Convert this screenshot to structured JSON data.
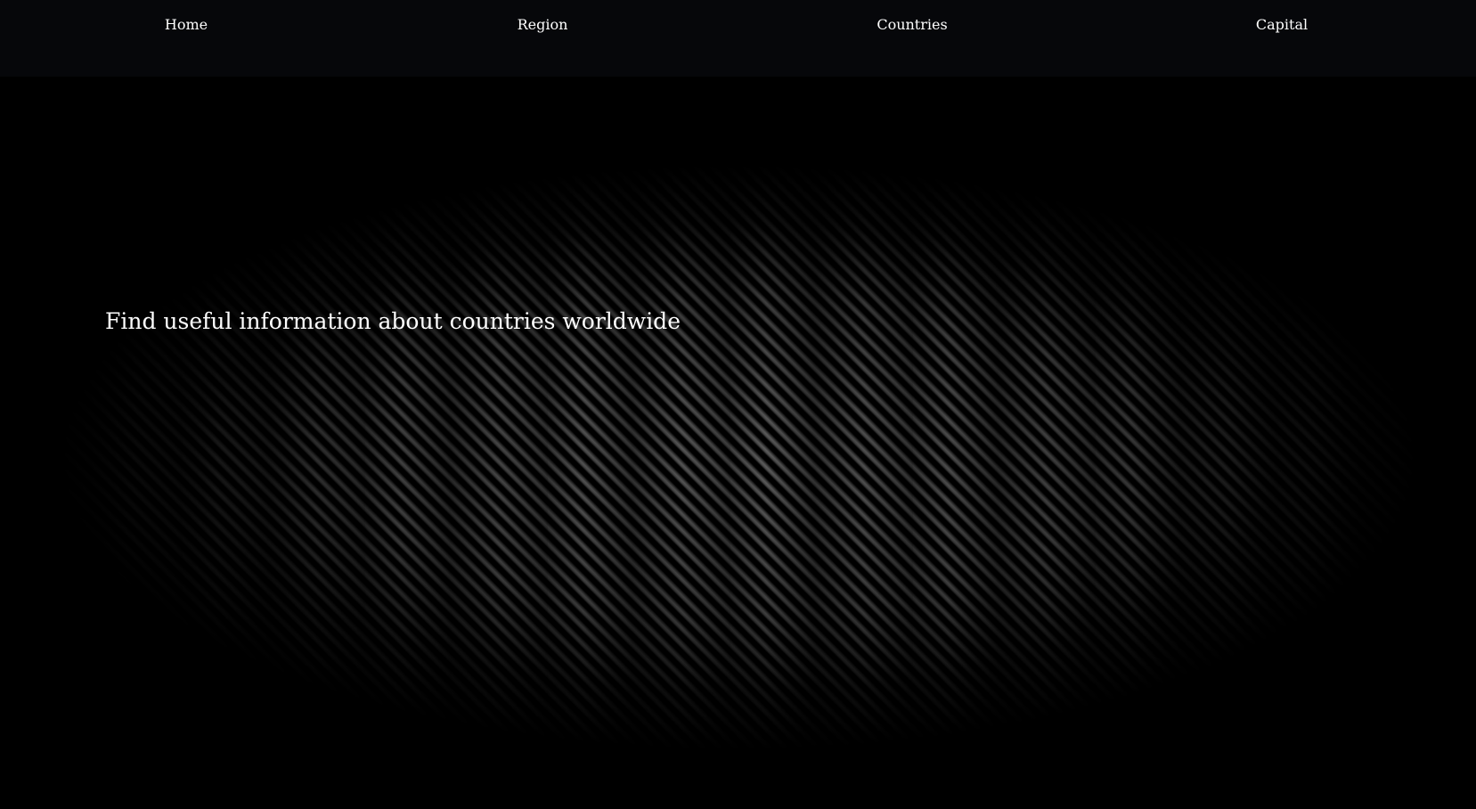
{
  "nav": {
    "items": [
      {
        "label": "Home"
      },
      {
        "label": "Region"
      },
      {
        "label": "Countries"
      },
      {
        "label": "Capital"
      }
    ]
  },
  "hero": {
    "headline": "Find useful information about countries worldwide"
  },
  "colors": {
    "navbar_background": "#06070a",
    "page_background": "#000000",
    "text": "#ffffff"
  }
}
